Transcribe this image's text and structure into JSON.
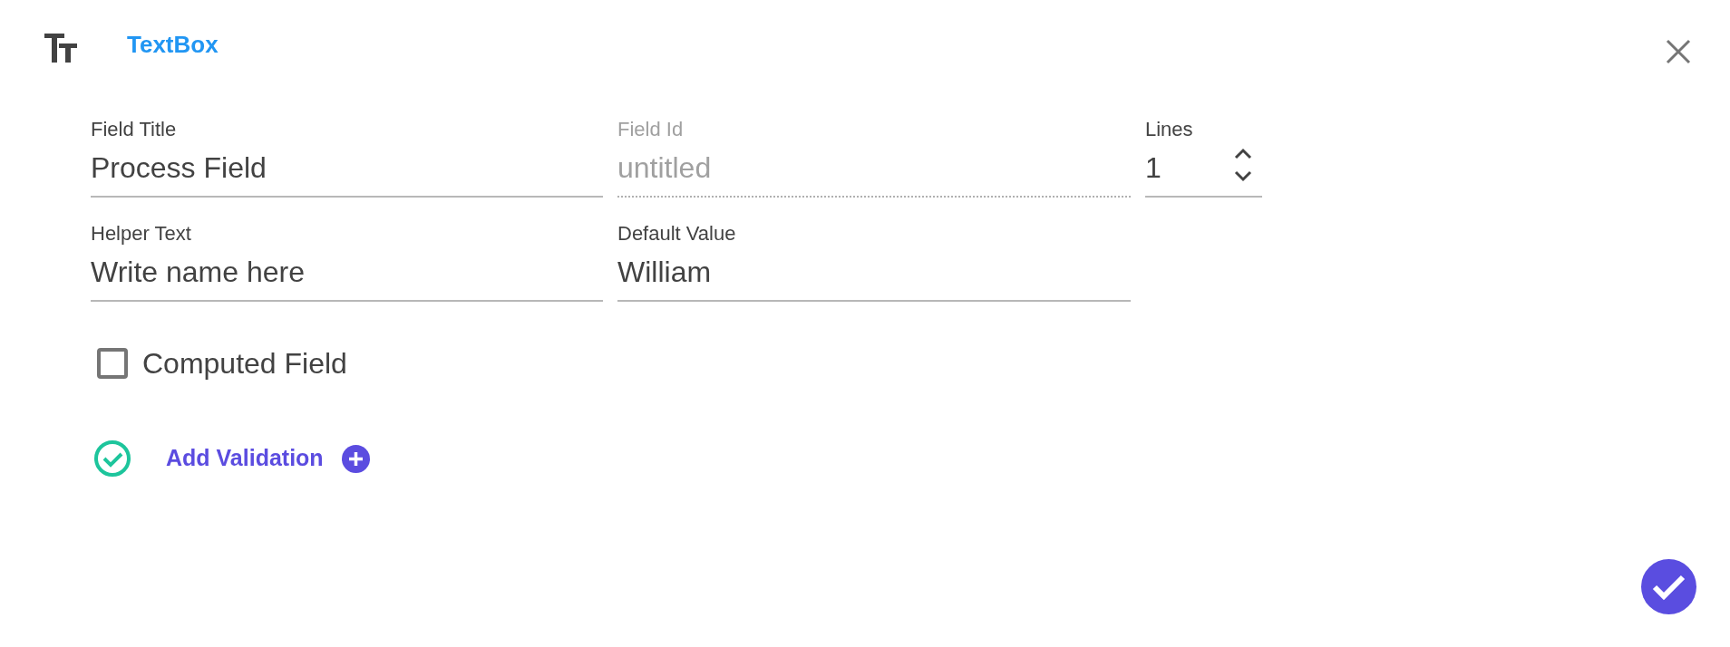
{
  "header": {
    "title": "TextBox"
  },
  "fields": [
    {
      "kind": "text",
      "label": "Field Title",
      "value": "Process Field",
      "disabled": false
    },
    {
      "kind": "text",
      "label": "Field Id",
      "placeholder": "untitled",
      "disabled": true
    },
    {
      "kind": "number",
      "label": "Lines",
      "value": "1",
      "disabled": false
    },
    {
      "kind": "text",
      "label": "Helper Text",
      "value": "Write name here",
      "disabled": false
    },
    {
      "kind": "text",
      "label": "Default Value",
      "value": "William",
      "disabled": false
    }
  ],
  "computed_field": {
    "label": "Computed Field",
    "checked": false
  },
  "validation": {
    "label": "Add Validation"
  }
}
